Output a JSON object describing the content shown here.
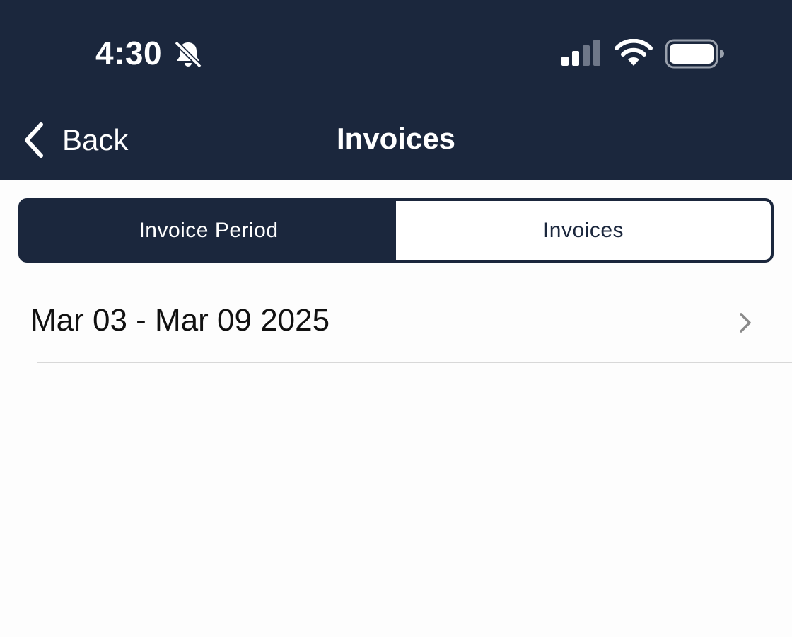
{
  "status_bar": {
    "time": "4:30",
    "icons": [
      "bell-slash-icon",
      "cellular-signal-icon",
      "wifi-icon",
      "battery-icon"
    ]
  },
  "nav": {
    "back_label": "Back",
    "title": "Invoices"
  },
  "segmented_control": {
    "segments": [
      {
        "label": "Invoice Period",
        "selected": false
      },
      {
        "label": "Invoices",
        "selected": true
      }
    ]
  },
  "list": {
    "items": [
      {
        "label": "Mar 03 - Mar 09 2025"
      }
    ]
  },
  "colors": {
    "header_background": "#1b273d",
    "page_background": "#fdfdfd",
    "divider": "#d8d8d8"
  }
}
